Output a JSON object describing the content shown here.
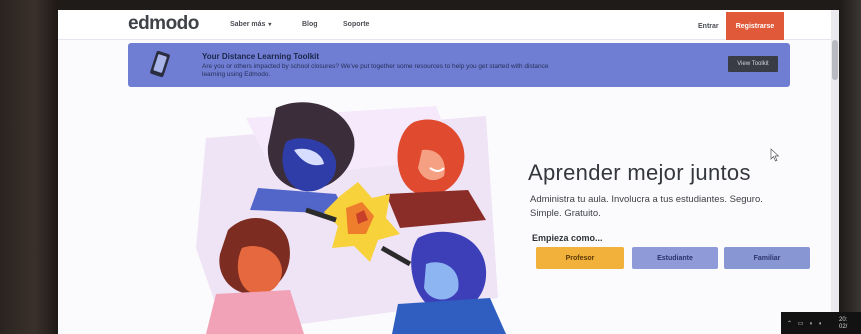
{
  "nav": {
    "logo": "edmodo",
    "saber_mas": "Saber más",
    "blog": "Blog",
    "soporte": "Soporte",
    "entrar": "Entrar",
    "registrarse": "Registrarse"
  },
  "banner": {
    "title": "Your Distance Learning Toolkit",
    "text": "Are you or others impacted by school closures? We've put together some resources to help you get started with distance learning using Edmodo.",
    "button": "View Toolkit"
  },
  "hero": {
    "title": "Aprender mejor juntos",
    "subtitle": "Administra tu aula. Involucra a tus estudiantes. Seguro. Simple. Gratuito.",
    "start_label": "Empieza como...",
    "roles": [
      "Profesor",
      "Estudiante",
      "Familiar"
    ]
  },
  "taskbar": {
    "time": "20:",
    "date": "02/"
  },
  "colors": {
    "banner": "#6f7ed3",
    "register": "#e05a3a",
    "profesor": "#f2b13a",
    "estudiante": "#8e9bd8",
    "familiar": "#8896d3"
  }
}
